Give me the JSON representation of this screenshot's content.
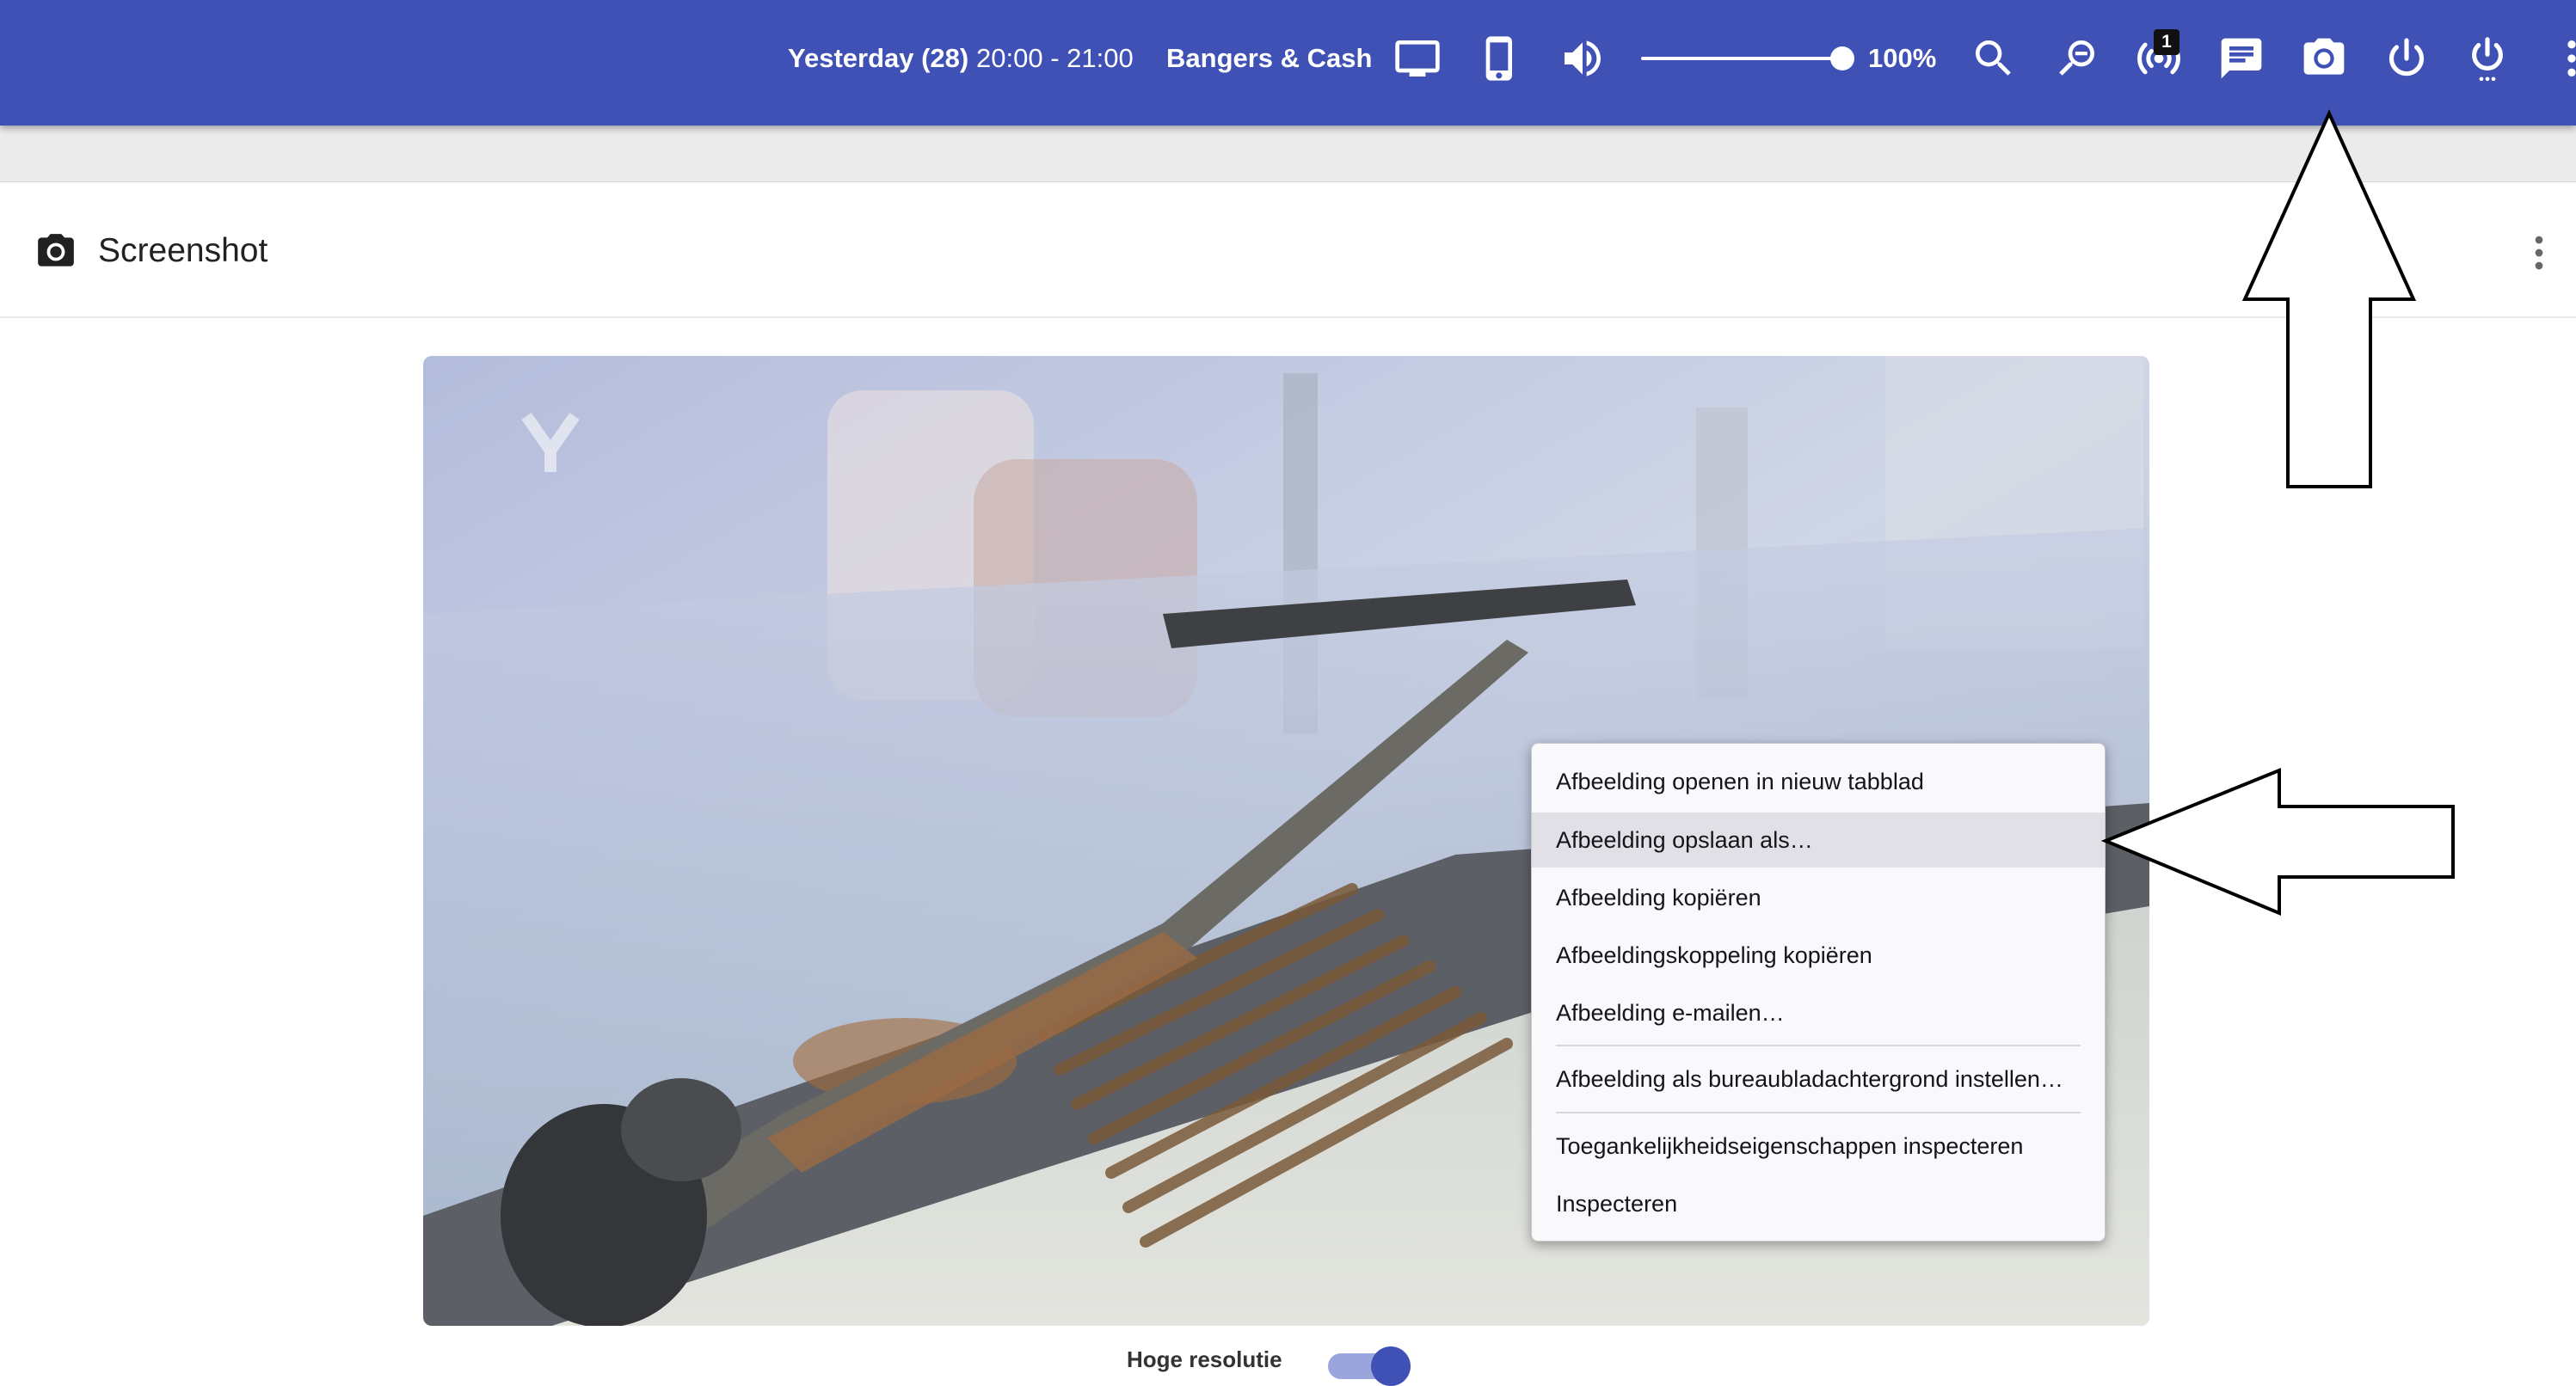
{
  "topbar": {
    "day": "Yesterday (28)",
    "time": "20:00 - 21:00",
    "program": "Bangers & Cash",
    "volume_percent": "100%",
    "volume_level": 1.0,
    "notification_count": "1",
    "icons": [
      "tv-icon",
      "phone-icon",
      "volume-icon",
      "search-icon",
      "zoom-out-icon",
      "broadcast-icon",
      "chat-icon",
      "camera-icon",
      "power-icon",
      "power-more-icon",
      "more-vert-icon"
    ],
    "color": "#3f51b5"
  },
  "panel": {
    "title": "Screenshot",
    "icon": "camera-icon"
  },
  "toggle": {
    "label": "Hoge resolutie",
    "checked": true
  },
  "context_menu": {
    "items": [
      "Afbeelding openen in nieuw tabblad",
      "Afbeelding opslaan als…",
      "Afbeelding kopiëren",
      "Afbeeldingskoppeling kopiëren",
      "Afbeelding e-mailen…",
      "Afbeelding als bureaubladachtergrond instellen…",
      "Toegankelijkheidseigenschappen inspecteren",
      "Inspecteren"
    ],
    "highlighted_index": 1
  }
}
